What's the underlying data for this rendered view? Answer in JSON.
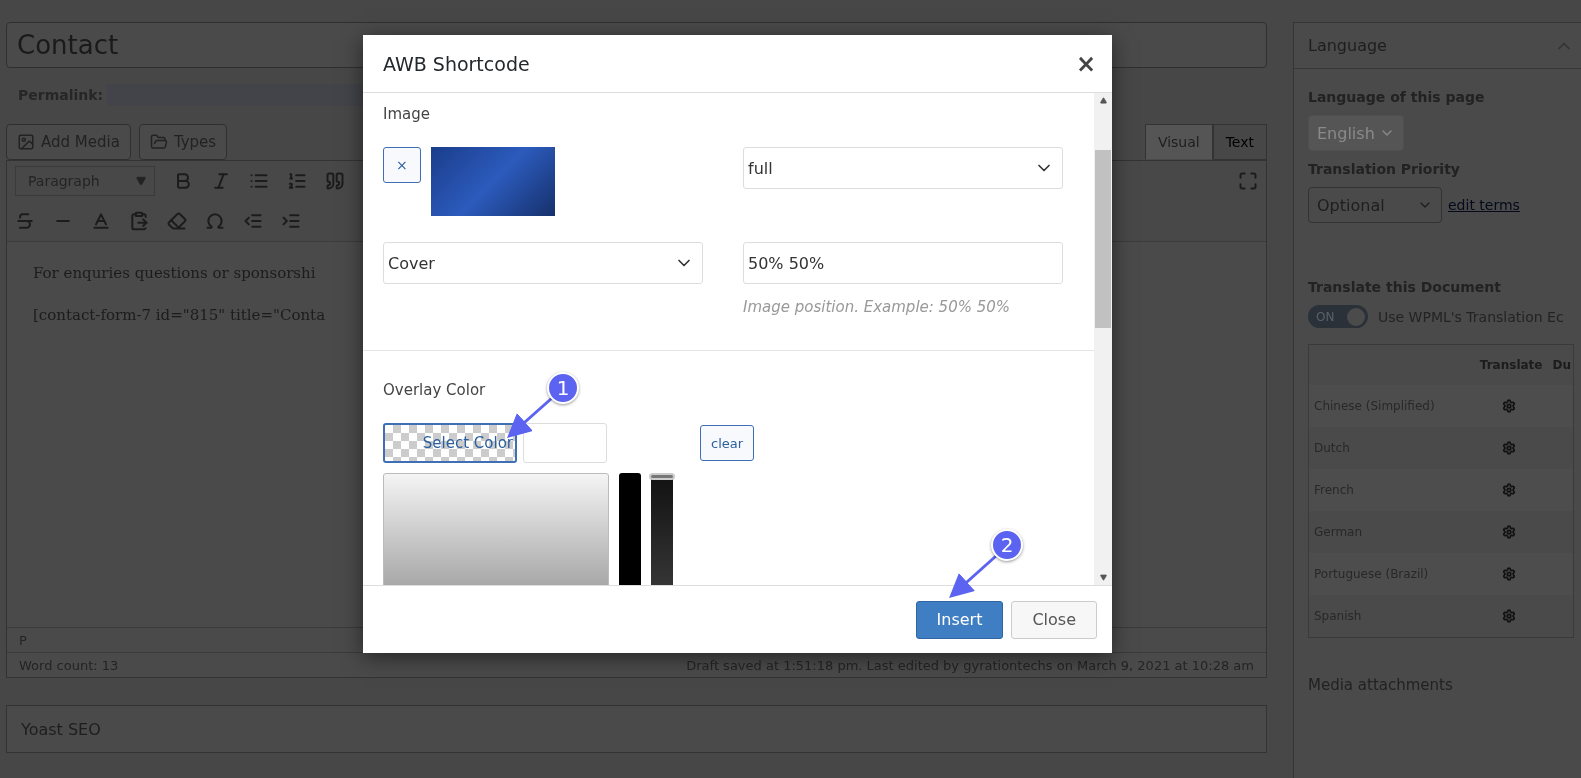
{
  "editor": {
    "title": "Contact",
    "permalink_label": "Permalink:",
    "media_buttons": [
      {
        "label": "Add Media",
        "kind": "media"
      },
      {
        "label": "Types",
        "kind": "types"
      }
    ],
    "tabs": [
      {
        "label": "Visual",
        "selected": true
      },
      {
        "label": "Text",
        "selected": false
      }
    ],
    "format_select": "Paragraph",
    "paragraphs": [
      "For enquries questions or sponsorshi",
      "[contact-form-7 id=\"815\" title=\"Conta"
    ],
    "path": "P",
    "word_count": "Word count: 13",
    "status": "Draft saved at 1:51:18 pm. Last edited by gyrationtechs on March 9, 2021 at 10:28 am"
  },
  "yoast": {
    "title": "Yoast SEO"
  },
  "sidebar": {
    "title": "Language",
    "language_label": "Language of this page",
    "language_select": {
      "value": "English",
      "disabled": true
    },
    "priority_label": "Translation Priority",
    "priority_select": {
      "value": "Optional",
      "disabled": false
    },
    "edit_link": "edit terms",
    "translate_heading": "Translate this Document",
    "toggle": {
      "label": "ON",
      "on": true
    },
    "toggle_text": "Use WPML's Translation Ec",
    "table": {
      "columns": [
        "Translate",
        "Du"
      ],
      "rows": [
        {
          "language": "Chinese (Simplified)"
        },
        {
          "language": "Dutch"
        },
        {
          "language": "French"
        },
        {
          "language": "German"
        },
        {
          "language": "Portuguese (Brazil)"
        },
        {
          "language": "Spanish"
        }
      ]
    },
    "media_attachments": "Media attachments"
  },
  "dialog": {
    "title": "AWB Shortcode",
    "close": "×",
    "image_label": "Image",
    "remove_button": "×",
    "size_select": "full",
    "fit_select": "Cover",
    "position_value": "50% 50%",
    "position_hint": "Image position. Example: 50% 50%",
    "overlay_label": "Overlay Color",
    "opacity_slider": {
      "level": 1
    },
    "select_color": "Select Color",
    "clear": "clear",
    "buttons": [
      {
        "label": "Insert",
        "kind": "primary"
      },
      {
        "label": "Close",
        "kind": "secondary"
      }
    ]
  },
  "annotations": [
    {
      "label": "1"
    },
    {
      "label": "2"
    }
  ]
}
